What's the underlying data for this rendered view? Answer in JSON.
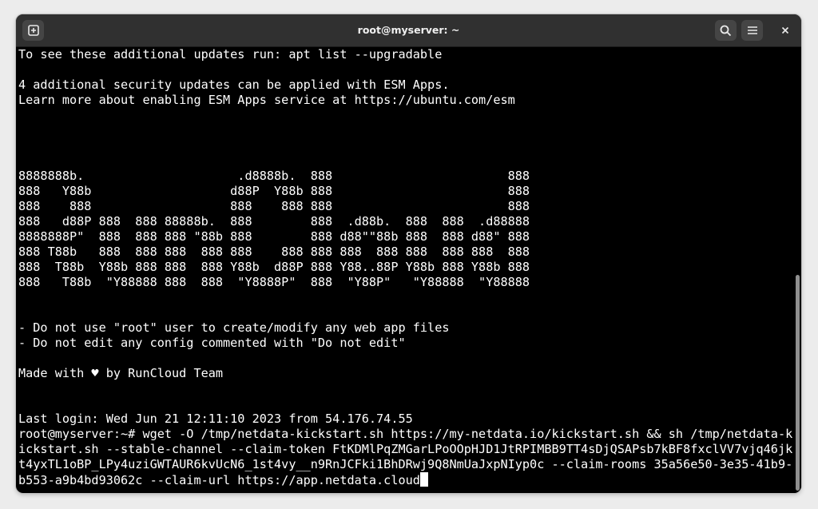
{
  "window": {
    "title": "root@myserver: ~",
    "icons": {
      "new_tab": "new-tab-icon",
      "search": "search-icon",
      "menu": "hamburger-menu-icon",
      "close": "close-icon"
    },
    "colors": {
      "titlebar": "#303030",
      "terminal_bg": "#000000",
      "terminal_fg": "#ffffff"
    }
  },
  "terminal": {
    "lines": [
      "To see these additional updates run: apt list --upgradable",
      "",
      "4 additional security updates can be applied with ESM Apps.",
      "Learn more about enabling ESM Apps service at https://ubuntu.com/esm",
      "",
      "",
      "",
      "",
      "8888888b.                     .d8888b.  888                        888",
      "888   Y88b                   d88P  Y88b 888                        888",
      "888    888                   888    888 888                        888",
      "888   d88P 888  888 88888b.  888        888  .d88b.  888  888  .d88888",
      "8888888P\"  888  888 888 \"88b 888        888 d88\"\"88b 888  888 d88\" 888",
      "888 T88b   888  888 888  888 888    888 888 888  888 888  888 888  888",
      "888  T88b  Y88b 888 888  888 Y88b  d88P 888 Y88..88P Y88b 888 Y88b 888",
      "888   T88b  \"Y88888 888  888  \"Y8888P\"  888  \"Y88P\"   \"Y88888  \"Y88888",
      "",
      "",
      "- Do not use \"root\" user to create/modify any web app files",
      "- Do not edit any config commented with \"Do not edit\"",
      "",
      "Made with ♥ by RunCloud Team",
      "",
      "",
      "Last login: Wed Jun 21 12:11:10 2023 from 54.176.74.55",
      "root@myserver:~# wget -O /tmp/netdata-kickstart.sh https://my-netdata.io/kickstart.sh && sh /tmp/netdata-k",
      "ickstart.sh --stable-channel --claim-token FtKDMlPqZMGarLPoOOpHJD1JtRPIMBB9TT4sDjQSAPsb7kBF8fxclVV7vjq46jk",
      "t4yxTL1oBP_LPy4uziGWTAUR6kvUcN6_1st4vy__n9RnJCFki1BhDRwj9Q8NmUaJxpNIyp0c --claim-rooms 35a56e50-3e35-41b9-",
      "b553-a9b4bd93062c --claim-url https://app.netdata.cloud"
    ]
  }
}
